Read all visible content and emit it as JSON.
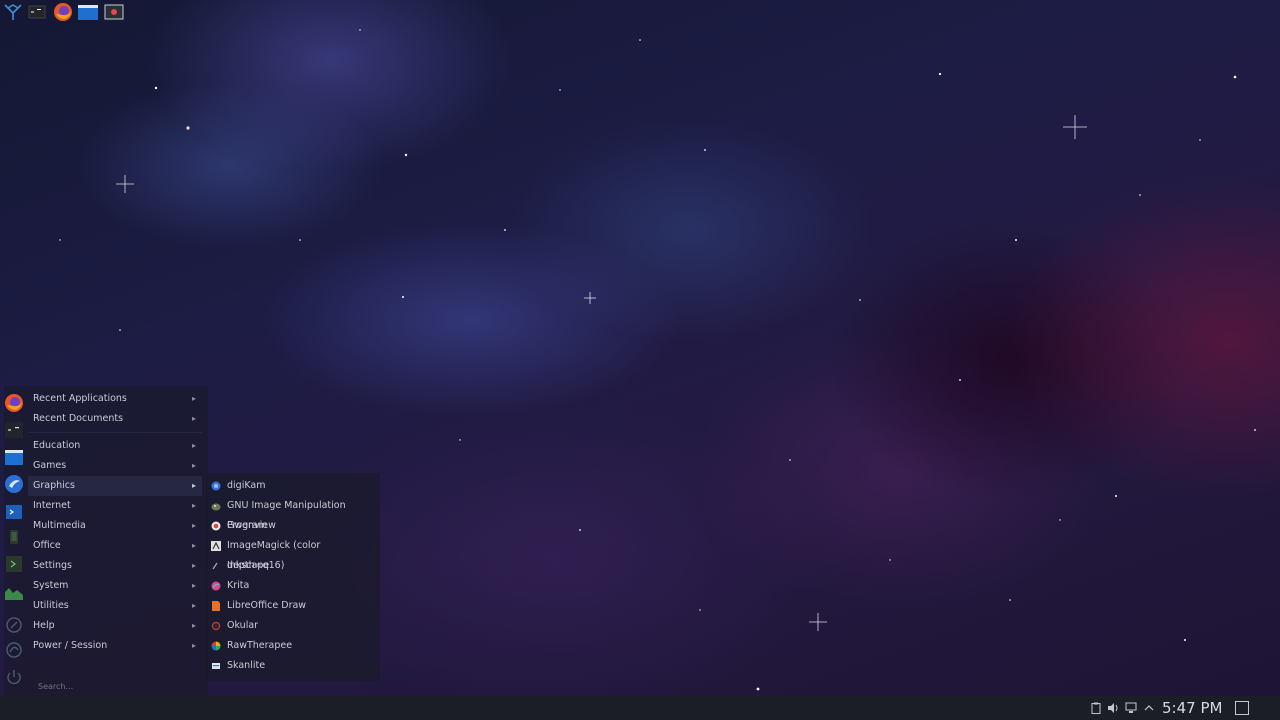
{
  "menu": {
    "categories": [
      {
        "label": "Recent Applications",
        "icon": "firefox-icon"
      },
      {
        "label": "Recent Documents",
        "icon": "terminal-icon"
      },
      {
        "label": "Education",
        "icon": "folder-icon"
      },
      {
        "label": "Games",
        "icon": "browser-icon"
      },
      {
        "label": "Graphics",
        "icon": "konsole-icon"
      },
      {
        "label": "Internet",
        "icon": "phone-icon"
      },
      {
        "label": "Multimedia",
        "icon": "terminal-icon"
      },
      {
        "label": "Office",
        "icon": "system-monitor-icon"
      },
      {
        "label": "Settings",
        "icon": "restart-icon"
      },
      {
        "label": "System",
        "icon": "restart-icon"
      },
      {
        "label": "Utilities",
        "icon": "power-icon"
      },
      {
        "label": "Help",
        "icon": ""
      },
      {
        "label": "Power / Session",
        "icon": ""
      }
    ],
    "active_category": "Graphics",
    "search_placeholder": "Search..."
  },
  "submenu": {
    "items": [
      {
        "label": "digiKam",
        "color": "#3a6fd8"
      },
      {
        "label": "GNU Image Manipulation Program",
        "color": "#6b7a55"
      },
      {
        "label": "Gwenview",
        "color": "#d84a3a"
      },
      {
        "label": "ImageMagick (color depth=q16)",
        "color": "#e0e0e0"
      },
      {
        "label": "Inkscape",
        "color": "#9aa0a8"
      },
      {
        "label": "Krita",
        "color": "#e2457b"
      },
      {
        "label": "LibreOffice Draw",
        "color": "#e8722a"
      },
      {
        "label": "Okular",
        "color": "#c0392b"
      },
      {
        "label": "RawTherapee",
        "color": "#e0b020"
      },
      {
        "label": "Skanlite",
        "color": "#9ab0c8"
      }
    ]
  },
  "taskbar": {
    "clock": "5:47 PM",
    "launchers": [
      "app-launcher-icon",
      "terminal-icon",
      "firefox-icon",
      "file-manager-icon",
      "screenshot-icon"
    ],
    "tray": [
      "clipboard-icon",
      "volume-icon",
      "network-icon",
      "expand-tray-icon"
    ]
  }
}
